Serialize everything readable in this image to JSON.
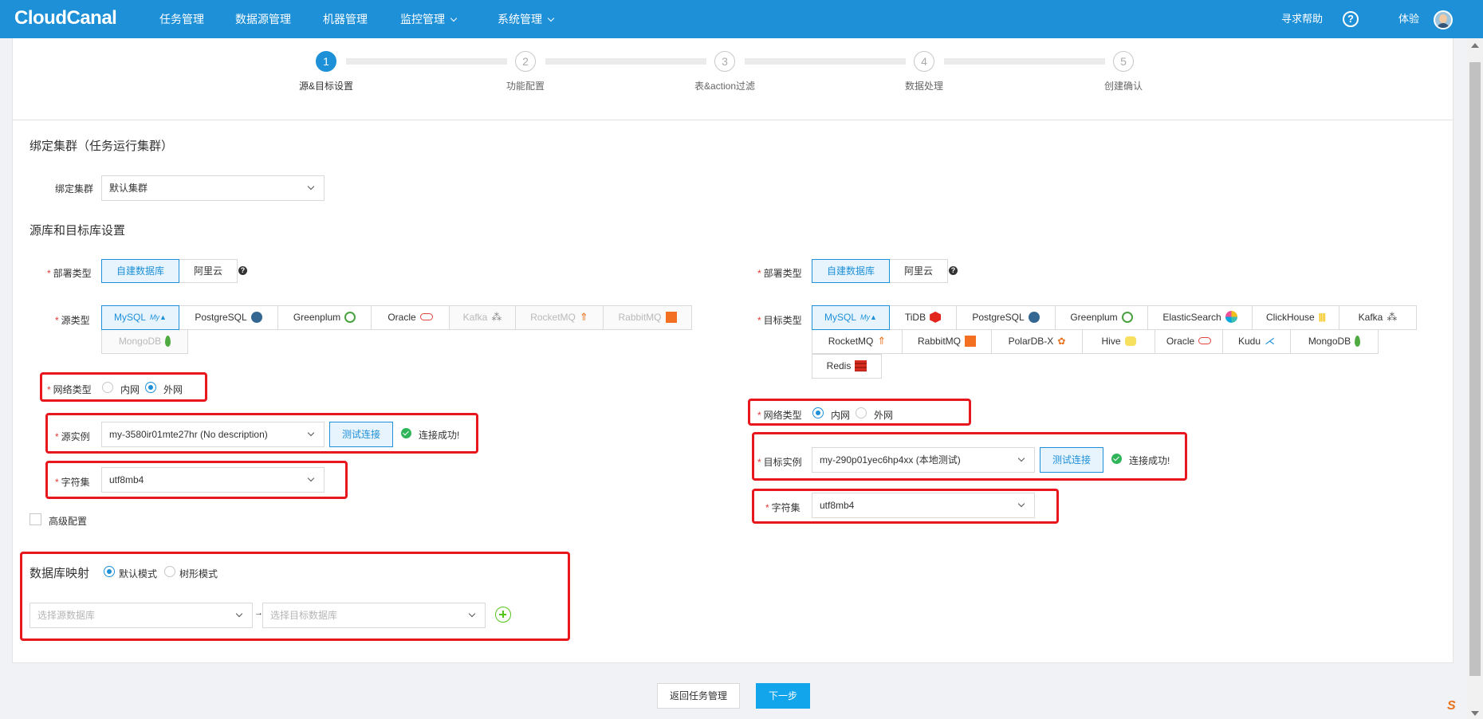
{
  "header": {
    "logo": "CloudCanal",
    "nav": [
      "任务管理",
      "数据源管理",
      "机器管理",
      "监控管理",
      "系统管理"
    ],
    "help_label": "寻求帮助",
    "help_icon": "?",
    "user_name": "体验"
  },
  "steps": [
    {
      "num": "1",
      "label": "源&目标设置"
    },
    {
      "num": "2",
      "label": "功能配置"
    },
    {
      "num": "3",
      "label": "表&action过滤"
    },
    {
      "num": "4",
      "label": "数据处理"
    },
    {
      "num": "5",
      "label": "创建确认"
    }
  ],
  "cluster": {
    "section_title": "绑定集群（任务运行集群）",
    "label": "绑定集群",
    "value": "默认集群"
  },
  "db_settings_title": "源库和目标库设置",
  "source": {
    "deploy_label": "部署类型",
    "deploy_options": [
      "自建数据库",
      "阿里云"
    ],
    "type_label": "源类型",
    "types": [
      "MySQL",
      "PostgreSQL",
      "Greenplum",
      "Oracle",
      "Kafka",
      "RocketMQ",
      "RabbitMQ",
      "MongoDB"
    ],
    "network_label": "网络类型",
    "network_options": [
      "内网",
      "外网"
    ],
    "instance_label": "源实例",
    "instance_value": "my-3580ir01mte27hr (No description)",
    "test_button": "测试连接",
    "success_text": "连接成功!",
    "charset_label": "字符集",
    "charset_value": "utf8mb4",
    "advanced_label": "高级配置"
  },
  "target": {
    "deploy_label": "部署类型",
    "deploy_options": [
      "自建数据库",
      "阿里云"
    ],
    "type_label": "目标类型",
    "types": [
      "MySQL",
      "TiDB",
      "PostgreSQL",
      "Greenplum",
      "ElasticSearch",
      "ClickHouse",
      "Kafka",
      "RocketMQ",
      "RabbitMQ",
      "PolarDB-X",
      "Hive",
      "Oracle",
      "Kudu",
      "MongoDB",
      "Redis"
    ],
    "network_label": "网络类型",
    "network_options": [
      "内网",
      "外网"
    ],
    "instance_label": "目标实例",
    "instance_value": "my-290p01yec6hp4xx (本地测试)",
    "test_button": "测试连接",
    "success_text": "连接成功!",
    "charset_label": "字符集",
    "charset_value": "utf8mb4"
  },
  "mapping": {
    "title": "数据库映射",
    "modes": [
      "默认模式",
      "树形模式"
    ],
    "source_placeholder": "选择源数据库",
    "target_placeholder": "选择目标数据库"
  },
  "footer": {
    "back_button": "返回任务管理",
    "next_button": "下一步"
  },
  "colors": {
    "header_bg": "#1d90d8",
    "accent": "#1d90d8",
    "highlight_box": "#e8161d",
    "next_button": "#13a5ec",
    "success": "#2fb45a"
  }
}
